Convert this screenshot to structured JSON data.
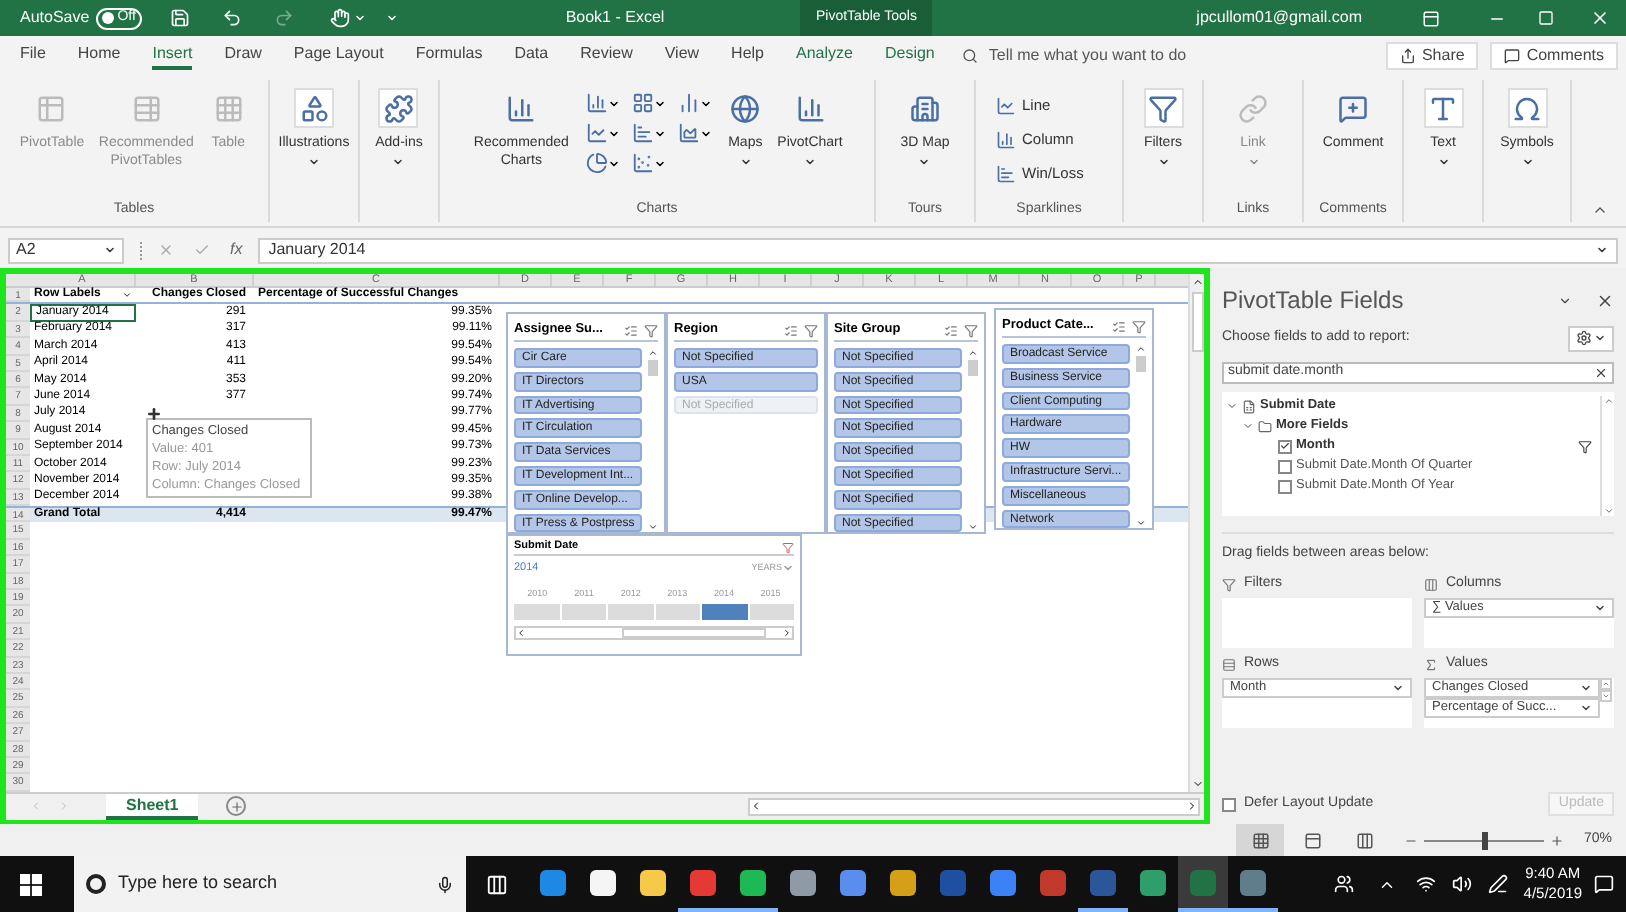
{
  "title_bar": {
    "autosave": {
      "label": "AutoSave",
      "on": false,
      "state_text": "Off"
    },
    "title": "Book1  -  Excel",
    "context": "PivotTable Tools",
    "account": "jpcullom01@gmail.com"
  },
  "menu_tabs": [
    {
      "label": "File",
      "selected": false,
      "kind": "normal"
    },
    {
      "label": "Home",
      "selected": false,
      "kind": "normal"
    },
    {
      "label": "Insert",
      "selected": true,
      "kind": "normal"
    },
    {
      "label": "Draw",
      "selected": false,
      "kind": "normal"
    },
    {
      "label": "Page Layout",
      "selected": false,
      "kind": "normal"
    },
    {
      "label": "Formulas",
      "selected": false,
      "kind": "normal"
    },
    {
      "label": "Data",
      "selected": false,
      "kind": "normal"
    },
    {
      "label": "Review",
      "selected": false,
      "kind": "normal"
    },
    {
      "label": "View",
      "selected": false,
      "kind": "normal"
    },
    {
      "label": "Help",
      "selected": false,
      "kind": "normal"
    },
    {
      "label": "Analyze",
      "selected": false,
      "kind": "contextual"
    },
    {
      "label": "Design",
      "selected": false,
      "kind": "contextual"
    }
  ],
  "tell_me": "Tell me what you want to do",
  "share": "Share",
  "comments": "Comments",
  "ribbon": [
    {
      "label": "Tables",
      "buttons": [
        {
          "kind": "large",
          "label": "PivotTable",
          "disabled": true,
          "dropdown": false
        },
        {
          "kind": "large",
          "label": "Recommended PivotTables",
          "disabled": true,
          "dropdown": false
        },
        {
          "kind": "large",
          "label": "Table",
          "disabled": true,
          "dropdown": false
        }
      ]
    },
    {
      "buttons": [
        {
          "kind": "boxed",
          "label": "Illustrations",
          "disabled": false,
          "dropdown": true
        }
      ]
    },
    {
      "buttons": [
        {
          "kind": "boxed",
          "label": "Add-ins",
          "disabled": false,
          "dropdown": true
        }
      ]
    },
    {
      "label": "Charts",
      "buttons": [
        {
          "kind": "large",
          "label": "Recommended Charts",
          "disabled": false,
          "dropdown": false
        },
        {
          "kind": "chart-grid",
          "disabled": false,
          "dropdown": true
        },
        {
          "kind": "large",
          "label": "Maps",
          "disabled": false,
          "dropdown": true
        },
        {
          "kind": "large",
          "label": "PivotChart",
          "disabled": false,
          "dropdown": true
        }
      ]
    },
    {
      "label": "Tours",
      "buttons": [
        {
          "kind": "large",
          "label": "3D Map",
          "disabled": false,
          "dropdown": true
        }
      ]
    },
    {
      "label": "Sparklines",
      "buttons": [
        {
          "kind": "small",
          "label": "Line",
          "disabled": false,
          "dropdown": false
        },
        {
          "kind": "small",
          "label": "Column",
          "disabled": false,
          "dropdown": false
        },
        {
          "kind": "small",
          "label": "Win/Loss",
          "disabled": false,
          "dropdown": false
        }
      ]
    },
    {
      "buttons": [
        {
          "kind": "boxed",
          "label": "Filters",
          "disabled": false,
          "dropdown": true
        }
      ]
    },
    {
      "label": "Links",
      "buttons": [
        {
          "kind": "large",
          "label": "Link",
          "disabled": true,
          "dropdown": true
        }
      ]
    },
    {
      "label": "Comments",
      "buttons": [
        {
          "kind": "large",
          "label": "Comment",
          "disabled": false,
          "dropdown": false
        }
      ]
    },
    {
      "buttons": [
        {
          "kind": "boxed",
          "label": "Text",
          "disabled": false,
          "dropdown": true
        }
      ]
    },
    {
      "buttons": [
        {
          "kind": "boxed",
          "label": "Symbols",
          "disabled": false,
          "dropdown": true
        }
      ]
    }
  ],
  "formula_bar": {
    "name_box": "A2",
    "function_label": "fx",
    "formula": "January 2014"
  },
  "columns": [
    "A",
    "B",
    "C",
    "D",
    "E",
    "F",
    "G",
    "H",
    "I",
    "J",
    "K",
    "L",
    "M",
    "N",
    "O",
    "P"
  ],
  "row_numbers": [
    "1",
    "2",
    "3",
    "4",
    "5",
    "6",
    "7",
    "8",
    "9",
    "10",
    "11",
    "12",
    "13",
    "14",
    "15",
    "16",
    "17",
    "18",
    "19",
    "20",
    "21",
    "22",
    "23",
    "24",
    "25",
    "26",
    "27",
    "28",
    "29",
    "30"
  ],
  "pivot": {
    "headers": [
      "Row Labels",
      "Changes Closed",
      "Percentage of Successful Changes"
    ],
    "rows": [
      {
        "label": "January 2014",
        "closed": "291",
        "percent": "99.35%",
        "selected": true
      },
      {
        "label": "February 2014",
        "closed": "317",
        "percent": "99.11%",
        "selected": false
      },
      {
        "label": "March 2014",
        "closed": "413",
        "percent": "99.54%",
        "selected": false
      },
      {
        "label": "April 2014",
        "closed": "411",
        "percent": "99.54%",
        "selected": false
      },
      {
        "label": "May 2014",
        "closed": "353",
        "percent": "99.20%",
        "selected": false
      },
      {
        "label": "June 2014",
        "closed": "377",
        "percent": "99.74%",
        "selected": false
      },
      {
        "label": "July 2014",
        "percent": "99.77%",
        "selected": false
      },
      {
        "label": "August 2014",
        "percent": "99.45%",
        "selected": false
      },
      {
        "label": "September 2014",
        "percent": "99.73%",
        "selected": false
      },
      {
        "label": "October 2014",
        "percent": "99.23%",
        "selected": false
      },
      {
        "label": "November 2014",
        "percent": "99.35%",
        "selected": false
      },
      {
        "label": "December 2014",
        "percent": "99.38%",
        "selected": false
      }
    ],
    "total": {
      "label": "Grand Total",
      "closed": "4,414",
      "percent": "99.47%"
    }
  },
  "tooltip": {
    "title": "Changes Closed",
    "lines": [
      "Value: 401",
      "Row: July 2014",
      "Column: Changes Closed"
    ]
  },
  "slicers": [
    {
      "title": "Assignee Su...",
      "items": [
        {
          "label": "Cir Care",
          "selected": true
        },
        {
          "label": "IT Directors",
          "selected": true
        },
        {
          "label": "IT Advertising",
          "selected": true
        },
        {
          "label": "IT Circulation",
          "selected": true
        },
        {
          "label": "IT Data Services",
          "selected": true
        },
        {
          "label": "IT Development Int...",
          "selected": true
        },
        {
          "label": "IT Online Develop...",
          "selected": true
        },
        {
          "label": "IT Press & Postpress",
          "selected": true
        }
      ]
    },
    {
      "title": "Region",
      "items": [
        {
          "label": "Not Specified",
          "selected": true
        },
        {
          "label": "USA",
          "selected": true
        },
        {
          "label": "Not Specified",
          "selected": false
        }
      ]
    },
    {
      "title": "Site Group",
      "items": [
        {
          "label": "Not Specified",
          "selected": true
        },
        {
          "label": "Not Specified",
          "selected": true
        },
        {
          "label": "Not Specified",
          "selected": true
        },
        {
          "label": "Not Specified",
          "selected": true
        },
        {
          "label": "Not Specified",
          "selected": true
        },
        {
          "label": "Not Specified",
          "selected": true
        },
        {
          "label": "Not Specified",
          "selected": true
        },
        {
          "label": "Not Specified",
          "selected": true
        }
      ]
    },
    {
      "title": "Product Cate...",
      "items": [
        {
          "label": "Broadcast Service",
          "selected": true
        },
        {
          "label": "Business Service",
          "selected": true
        },
        {
          "label": "Client Computing",
          "selected": true
        },
        {
          "label": "Hardware",
          "selected": true
        },
        {
          "label": "HW",
          "selected": true
        },
        {
          "label": "Infrastructure Servi...",
          "selected": true
        },
        {
          "label": "Miscellaneous",
          "selected": true
        },
        {
          "label": "Network",
          "selected": true
        }
      ]
    }
  ],
  "timeline": {
    "title": "Submit  Date",
    "period": "2014",
    "level": "YEARS",
    "years": [
      {
        "label": "2010",
        "selected": false
      },
      {
        "label": "2011",
        "selected": false
      },
      {
        "label": "2012",
        "selected": false
      },
      {
        "label": "2013",
        "selected": false
      },
      {
        "label": "2014",
        "selected": true
      },
      {
        "label": "2015",
        "selected": false
      }
    ]
  },
  "sheet_tabs": [
    {
      "label": "Sheet1",
      "selected": true
    }
  ],
  "pane": {
    "title": "PivotTable Fields",
    "prompt": "Choose fields to add to report:",
    "search": "submit date.month",
    "fields": [
      {
        "label": "Submit Date",
        "kind": "table",
        "expanded": true,
        "children": [
          {
            "label": "More Fields",
            "kind": "folder",
            "expanded": true,
            "children": [
              {
                "label": "Month",
                "kind": "field",
                "checked": true,
                "filtered": true
              },
              {
                "label": "Submit Date.Month Of Quarter",
                "kind": "field",
                "checked": false,
                "filtered": false
              },
              {
                "label": "Submit Date.Month Of Year",
                "kind": "field",
                "checked": false,
                "filtered": false
              }
            ]
          }
        ]
      }
    ],
    "drag_hint": "Drag fields between areas below:",
    "areas": [
      {
        "title": "Filters",
        "kind": "filters"
      },
      {
        "title": "Columns",
        "kind": "columns",
        "items": [
          "∑ Values"
        ]
      },
      {
        "title": "Rows",
        "kind": "rows",
        "items": [
          "Month"
        ]
      },
      {
        "title": "Values",
        "kind": "values",
        "items": [
          "Changes Closed",
          "Percentage of Succ..."
        ]
      }
    ],
    "defer": {
      "label": "Defer Layout Update",
      "checked": false
    },
    "update": {
      "label": "Update",
      "disabled": true
    }
  },
  "status": {
    "views": [
      {
        "selected": true
      },
      {
        "selected": false
      },
      {
        "selected": false
      }
    ],
    "zoom_slider": {
      "level": 0.5
    },
    "zoom": "70%"
  },
  "taskbar": {
    "search": "Type here to search",
    "time": "9:40 AM",
    "date": "4/5/2019",
    "apps": [
      {
        "running": false,
        "active": false
      },
      {
        "running": false,
        "active": false
      },
      {
        "running": false,
        "active": false
      },
      {
        "running": true,
        "active": false
      },
      {
        "running": true,
        "active": false
      },
      {
        "running": false,
        "active": false
      },
      {
        "running": false,
        "active": false
      },
      {
        "running": false,
        "active": false
      },
      {
        "running": false,
        "active": false
      },
      {
        "running": false,
        "active": false
      },
      {
        "running": false,
        "active": false
      },
      {
        "running": true,
        "active": false
      },
      {
        "running": false,
        "active": false
      },
      {
        "running": true,
        "active": true
      },
      {
        "running": true,
        "active": false
      }
    ]
  }
}
